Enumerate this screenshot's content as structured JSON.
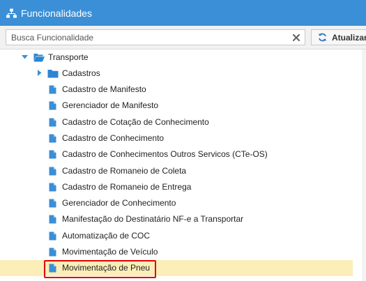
{
  "header": {
    "title": "Funcionalidades",
    "icon": "sitemap-icon"
  },
  "search": {
    "placeholder": "Busca Funcionalidade",
    "value": ""
  },
  "toolbar": {
    "refresh_label": "Atualizar"
  },
  "colors": {
    "header_bg": "#3a8fd6",
    "folder": "#2b86d3",
    "file": "#3a8fd6",
    "selected_bg": "#fbeeb9",
    "highlight_border": "#e00000"
  },
  "tree": {
    "root": {
      "label": "Transporte",
      "expanded": true
    },
    "folder": {
      "label": "Cadastros",
      "expanded": false
    },
    "items": [
      "Cadastro de Manifesto",
      "Gerenciador de Manifesto",
      "Cadastro de Cotação de Conhecimento",
      "Cadastro de Conhecimento",
      "Cadastro de Conhecimentos Outros Servicos (CTe-OS)",
      "Cadastro de Romaneio de Coleta",
      "Cadastro de Romaneio de Entrega",
      "Gerenciador de Conhecimento",
      "Manifestação do Destinatário NF-e a Transportar",
      "Automatização de COC",
      "Movimentação de Veículo",
      "Movimentação de Pneu"
    ],
    "selected_index": 11
  }
}
